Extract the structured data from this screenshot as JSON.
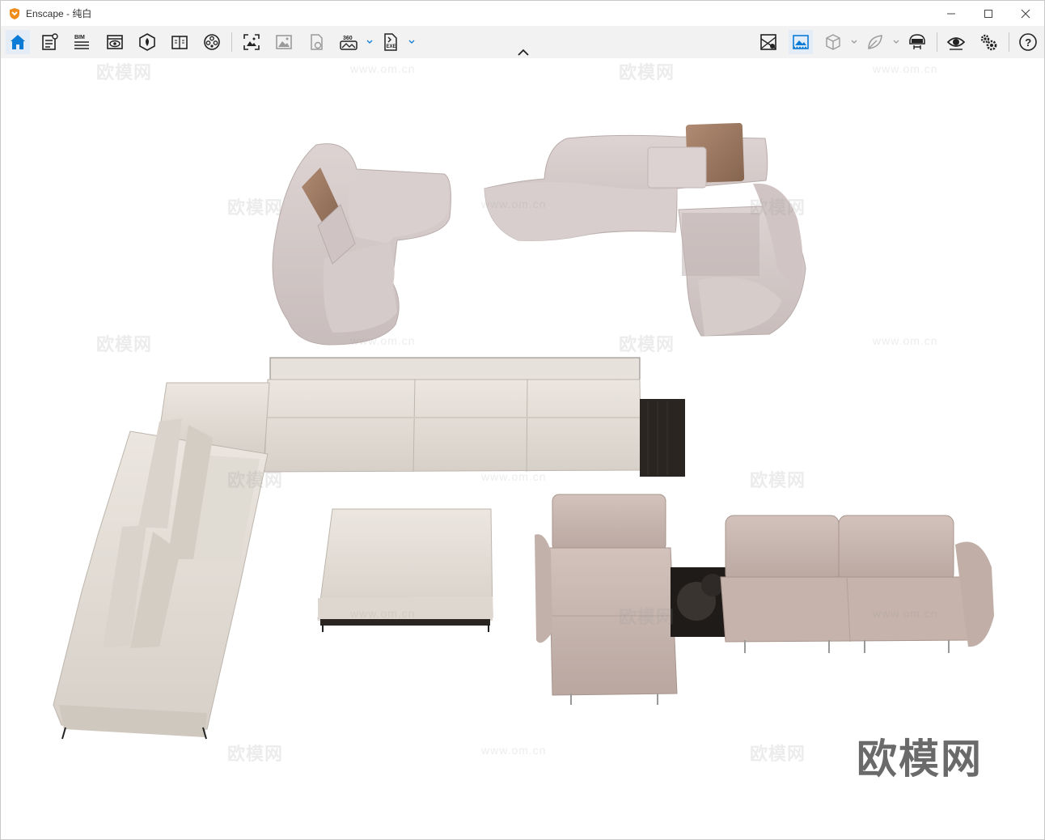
{
  "window": {
    "app_name": "Enscape",
    "title": "Enscape - 纯白",
    "controls": [
      "minimize",
      "maximize",
      "close"
    ]
  },
  "toolbar": {
    "left_icons": [
      {
        "name": "home-icon",
        "active": true
      },
      {
        "name": "information-icon"
      },
      {
        "name": "bim-icon",
        "label": "BIM"
      },
      {
        "name": "views-icon"
      },
      {
        "name": "asset-library-icon"
      },
      {
        "name": "atlas-icon"
      },
      {
        "name": "material-icon"
      },
      {
        "name": "screenshot-icon"
      },
      {
        "name": "image-icon"
      },
      {
        "name": "capture-icon"
      },
      {
        "name": "panorama-360-icon",
        "label": "360"
      },
      {
        "name": "export-exe-icon",
        "label": "EXE"
      }
    ],
    "right_icons": [
      {
        "name": "map-icon"
      },
      {
        "name": "background-icon",
        "active": true
      },
      {
        "name": "box-icon"
      },
      {
        "name": "leaf-icon"
      },
      {
        "name": "vr-headset-icon"
      },
      {
        "name": "eye-settings-icon"
      },
      {
        "name": "settings-icon"
      },
      {
        "name": "help-icon",
        "label": "?"
      }
    ]
  },
  "viewport": {
    "watermarks": [
      "欧模网",
      "www.om.cn"
    ],
    "brand_watermark": "欧模网"
  },
  "colors": {
    "accent": "#0a7bd6",
    "toolbar_bg": "#f2f2f2",
    "fabric_mauve": "#d6cdcc",
    "fabric_beige": "#e4dfd8",
    "leather_taupe": "#c7b5ae",
    "pillow_brown": "#a07c66",
    "wood_dark": "#2b2521"
  }
}
